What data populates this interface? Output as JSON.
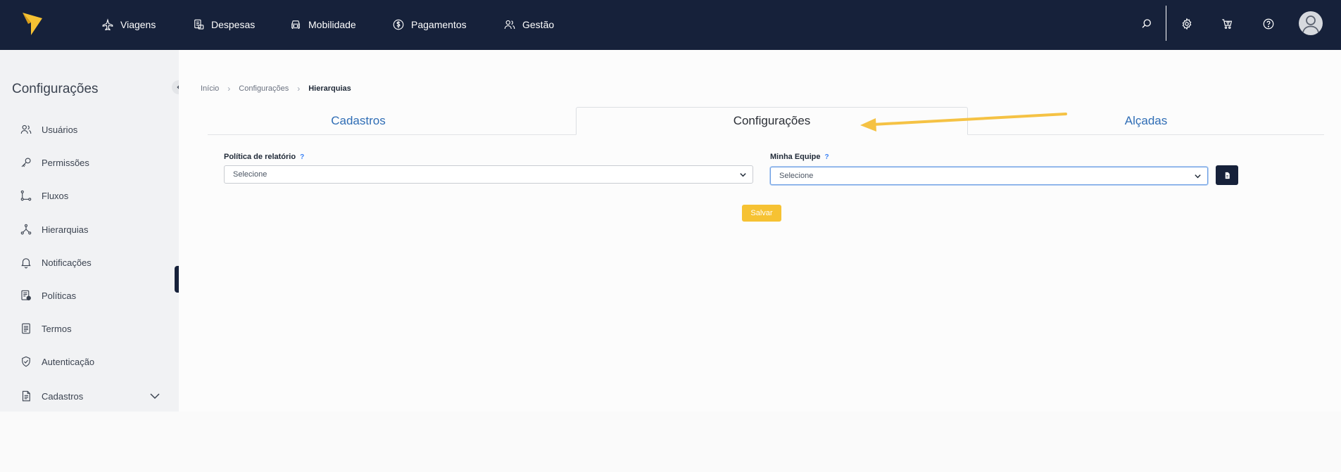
{
  "topbar": {
    "nav": [
      {
        "label": "Viagens",
        "icon": "plane-icon"
      },
      {
        "label": "Despesas",
        "icon": "receipt-icon"
      },
      {
        "label": "Mobilidade",
        "icon": "car-icon"
      },
      {
        "label": "Pagamentos",
        "icon": "dollar-circle-icon"
      },
      {
        "label": "Gestão",
        "icon": "users-icon"
      }
    ],
    "actions": [
      "search-icon",
      "gear-icon",
      "cart-icon",
      "help-circle-icon",
      "avatar"
    ]
  },
  "sidebar": {
    "title": "Configurações",
    "items": [
      {
        "label": "Usuários",
        "icon": "users-icon"
      },
      {
        "label": "Permissões",
        "icon": "key-icon"
      },
      {
        "label": "Fluxos",
        "icon": "flow-icon"
      },
      {
        "label": "Hierarquias",
        "icon": "hierarchy-icon"
      },
      {
        "label": "Notificações",
        "icon": "bell-icon"
      },
      {
        "label": "Políticas",
        "icon": "policy-document-icon"
      },
      {
        "label": "Termos",
        "icon": "terms-document-icon"
      },
      {
        "label": "Autenticação",
        "icon": "shield-check-icon"
      },
      {
        "label": "Cadastros",
        "icon": "file-list-icon"
      }
    ],
    "active": "Hierarquias"
  },
  "breadcrumb": {
    "items": [
      "Início",
      "Configurações",
      "Hierarquias"
    ]
  },
  "tabs": [
    {
      "label": "Cadastros",
      "active": false
    },
    {
      "label": "Configurações",
      "active": true
    },
    {
      "label": "Alçadas",
      "active": false
    }
  ],
  "form": {
    "report_policy": {
      "label": "Política de relatório",
      "value": "Selecione"
    },
    "my_team": {
      "label": "Minha Equipe",
      "value": "Selecione"
    },
    "help_glyph": "?",
    "save_label": "Salvar"
  },
  "colors": {
    "topbar": "#16213a",
    "accent_yellow": "#f6c233",
    "link_blue": "#2f6db5",
    "annotation_arrow": "#f5c244"
  }
}
